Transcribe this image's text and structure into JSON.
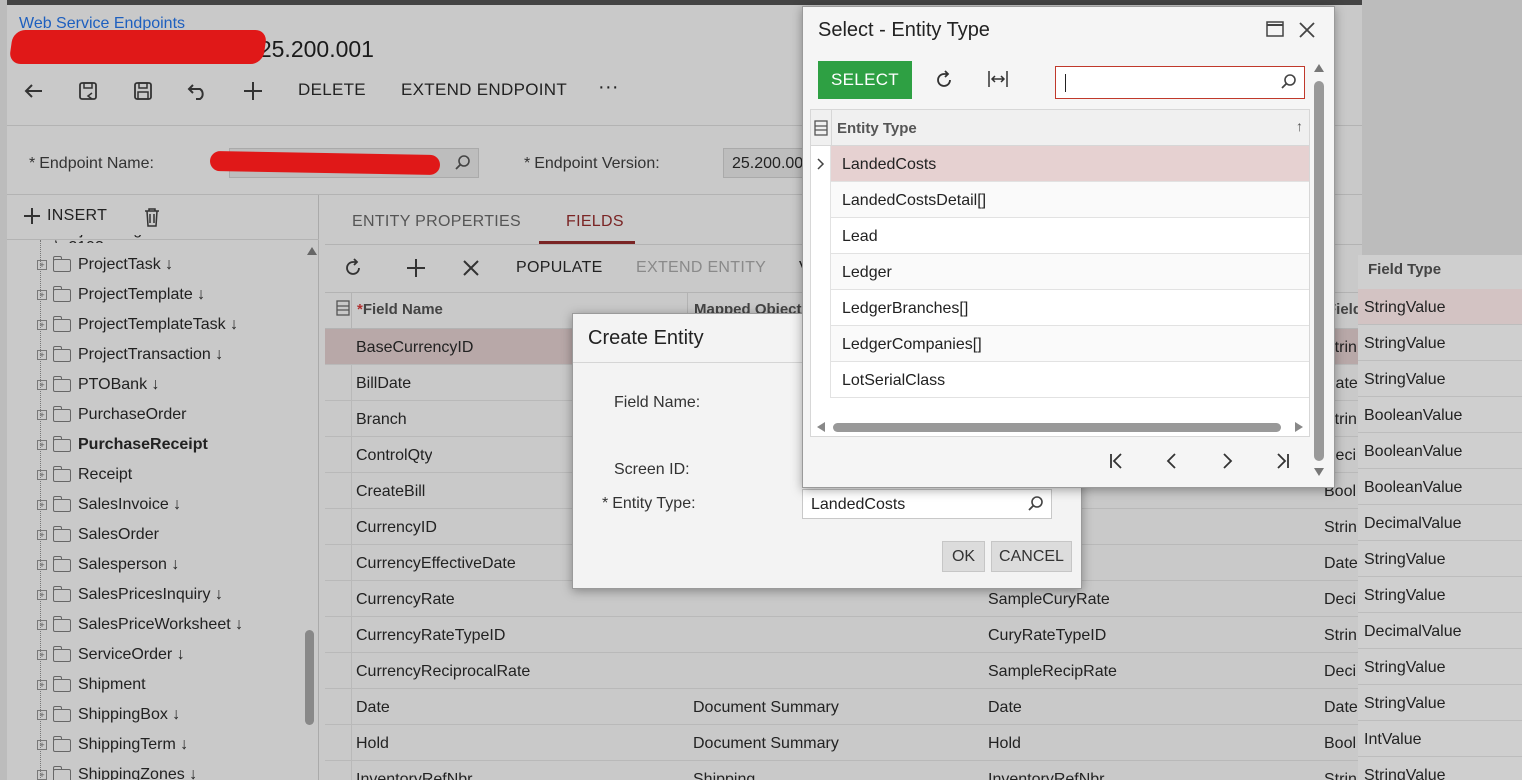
{
  "breadcrumb": "Web Service Endpoints",
  "title": "ndpoint 25.200.001",
  "toolbar": {
    "delete_label": "DELETE",
    "extend_label": "EXTEND ENDPOINT",
    "more_label": "···"
  },
  "form": {
    "endpoint_name_label": "Endpoint Name:",
    "endpoint_version_label": "Endpoint Version:",
    "endpoint_version_value": "25.200.00"
  },
  "left_panel": {
    "insert_label": "INSERT",
    "tree": [
      {
        "label": "ProjectTask ↓",
        "bold": false
      },
      {
        "label": "ProjectTemplate ↓",
        "bold": false
      },
      {
        "label": "ProjectTemplateTask ↓",
        "bold": false
      },
      {
        "label": "ProjectTransaction ↓",
        "bold": false
      },
      {
        "label": "PTOBank ↓",
        "bold": false
      },
      {
        "label": "PurchaseOrder",
        "bold": false
      },
      {
        "label": "PurchaseReceipt",
        "bold": true
      },
      {
        "label": "Receipt",
        "bold": false
      },
      {
        "label": "SalesInvoice ↓",
        "bold": false
      },
      {
        "label": "SalesOrder",
        "bold": false
      },
      {
        "label": "Salesperson ↓",
        "bold": false
      },
      {
        "label": "SalesPricesInquiry ↓",
        "bold": false
      },
      {
        "label": "SalesPriceWorksheet ↓",
        "bold": false
      },
      {
        "label": "ServiceOrder ↓",
        "bold": false
      },
      {
        "label": "Shipment",
        "bold": false
      },
      {
        "label": "ShippingBox ↓",
        "bold": false
      },
      {
        "label": "ShippingTerm ↓",
        "bold": false
      },
      {
        "label": "ShippingZones ↓",
        "bold": false
      }
    ]
  },
  "tabs": {
    "entity_properties": "ENTITY PROPERTIES",
    "fields": "FIELDS"
  },
  "grid_toolbar": {
    "populate": "POPULATE",
    "extend_entity": "EXTEND ENTITY",
    "cut_letter": "V"
  },
  "grid": {
    "headers": {
      "field_name": "Field Name",
      "mapped_object": "Mapped Object",
      "field_type": "Field Type",
      "field_cut": "Field"
    },
    "rows": [
      {
        "name": "BaseCurrencyID",
        "mapped": "",
        "field": "",
        "type_cut": "Strin",
        "type": "StringValue"
      },
      {
        "name": "BillDate",
        "mapped": "",
        "field": "",
        "type_cut": "Date",
        "type": "StringValue"
      },
      {
        "name": "Branch",
        "mapped": "",
        "field": "",
        "type_cut": "Strin",
        "type": "StringValue"
      },
      {
        "name": "ControlQty",
        "mapped": "",
        "field": "",
        "type_cut": "Deci",
        "type": "BooleanValue"
      },
      {
        "name": "CreateBill",
        "mapped": "",
        "field": "",
        "type_cut": "Bool",
        "type": "BooleanValue"
      },
      {
        "name": "CurrencyID",
        "mapped": "",
        "field": "",
        "type_cut": "Strin",
        "type": "BooleanValue"
      },
      {
        "name": "CurrencyEffectiveDate",
        "mapped": "",
        "field": "",
        "type_cut": "Date",
        "type": "DecimalValue"
      },
      {
        "name": "CurrencyRate",
        "mapped": "",
        "field": "SampleCuryRate",
        "type_cut": "Deci",
        "type": "StringValue"
      },
      {
        "name": "CurrencyRateTypeID",
        "mapped": "",
        "field": "CuryRateTypeID",
        "type_cut": "Strin",
        "type": "StringValue"
      },
      {
        "name": "CurrencyReciprocalRate",
        "mapped": "",
        "field": "SampleRecipRate",
        "type_cut": "Deci",
        "type": "DecimalValue"
      },
      {
        "name": "Date",
        "mapped": "Document Summary",
        "field": "Date",
        "type_cut": "Date",
        "type": "StringValue"
      },
      {
        "name": "Hold",
        "mapped": "Document Summary",
        "field": "Hold",
        "type_cut": "Bool",
        "type": "StringValue"
      },
      {
        "name": "InventoryRefNbr",
        "mapped": "Shipping",
        "field": "InventoryRefNbr",
        "type_cut": "Strin",
        "type": "IntValue"
      }
    ],
    "extra_type": "StringValue"
  },
  "create_entity": {
    "title": "Create Entity",
    "field_name_label": "Field Name:",
    "screen_id_label": "Screen ID:",
    "entity_type_label": "Entity Type:",
    "entity_type_value": "LandedCosts",
    "ok": "OK",
    "cancel": "CANCEL"
  },
  "select_dialog": {
    "title": "Select - Entity Type",
    "select_button": "SELECT",
    "search_value": "",
    "column_header": "Entity Type",
    "rows": [
      "LandedCosts",
      "LandedCostsDetail[]",
      "Lead",
      "Ledger",
      "LedgerBranches[]",
      "LedgerCompanies[]",
      "LotSerialClass"
    ]
  },
  "colors": {
    "link": "#1d5fbf",
    "select_button": "#2ea043",
    "selected_row": "#e6d1d1",
    "search_border": "#c0392b"
  }
}
